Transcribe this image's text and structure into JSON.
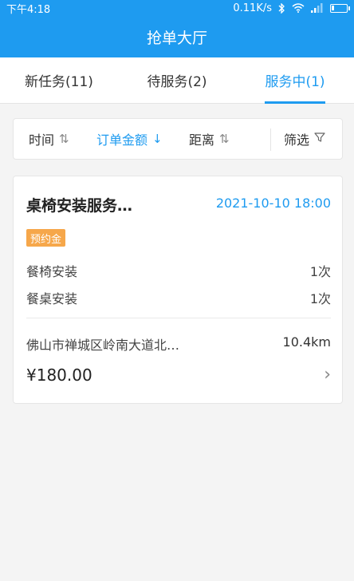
{
  "status_bar": {
    "time": "下午4:18",
    "network_speed": "0.11K/s",
    "icons": [
      "bluetooth-icon",
      "wifi-icon",
      "signal-icon",
      "battery-icon"
    ],
    "battery_level": 0.2
  },
  "header": {
    "title": "抢单大厅"
  },
  "tabs": [
    {
      "label": "新任务(11)",
      "active": false
    },
    {
      "label": "待服务(2)",
      "active": false
    },
    {
      "label": "服务中(1)",
      "active": true
    }
  ],
  "filter_bar": {
    "time_label": "时间",
    "amount_label": "订单金额",
    "distance_label": "距离",
    "filter_label": "筛选",
    "sort_icon_updown": "⇅",
    "sort_icon_down": "↓",
    "filter_icon": "▽"
  },
  "order": {
    "title": "桌椅安装服务…",
    "datetime": "2021-10-10 18:00",
    "badge": "预约金",
    "items": [
      {
        "name": "餐椅安装",
        "count": "1次"
      },
      {
        "name": "餐桌安装",
        "count": "1次"
      }
    ],
    "address": "佛山市禅城区岭南大道北…",
    "distance": "10.4km",
    "price": "¥180.00",
    "chevron": "›"
  },
  "colors": {
    "primary": "#1e9bf0",
    "badge": "#f6a74a",
    "background": "#f4f4f4"
  }
}
